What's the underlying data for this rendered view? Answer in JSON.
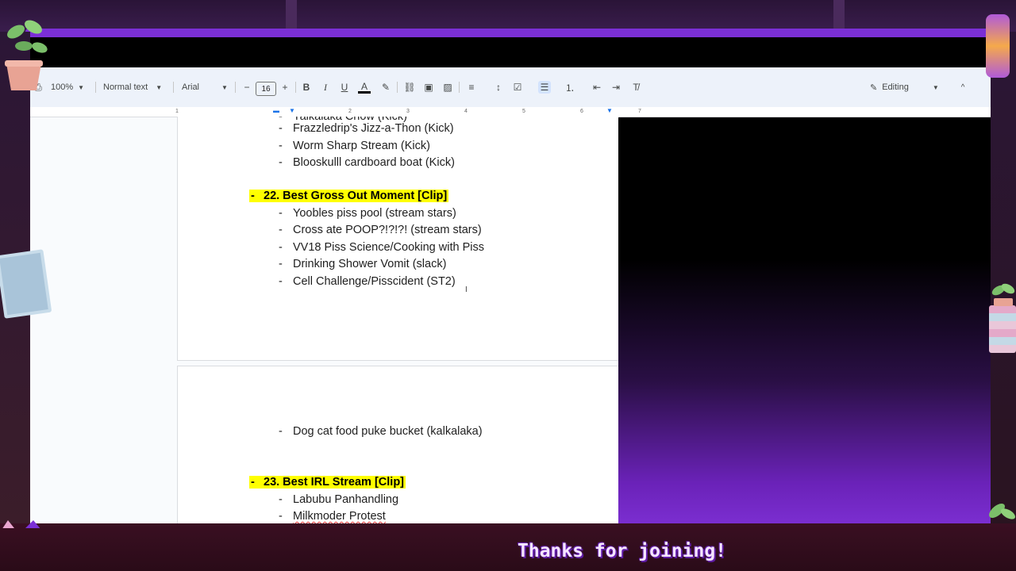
{
  "toolbar": {
    "zoom": "100%",
    "style": "Normal text",
    "font": "Arial",
    "font_size": "16",
    "mode": "Editing"
  },
  "ruler": {
    "ticks": [
      "1",
      "2",
      "3",
      "4",
      "5",
      "6",
      "7"
    ]
  },
  "document": {
    "partial_top": "Yalkalaka Chow (Kick)",
    "items_a": [
      "Frazzledrip's Jizz-a-Thon (Kick)",
      "Worm Sharp Stream (Kick)",
      "Blooskulll cardboard boat (Kick)"
    ],
    "heading_22": "22. Best Gross Out Moment [Clip]",
    "items_22": [
      "Yoobles piss pool (stream stars)",
      "Cross ate POOP?!?!?! (stream stars)",
      "VV18 Piss Science/Cooking with Piss",
      "Drinking Shower Vomit (slack)",
      "Cell Challenge/Pisscident (ST2)"
    ],
    "item_page2": "Dog cat food puke bucket (kalkalaka)",
    "heading_23": "23. Best IRL Stream [Clip]",
    "items_23": [
      "Labubu Panhandling",
      "Milkmoder Protest"
    ]
  },
  "overlay": {
    "caption": "Thanks for joining!"
  }
}
